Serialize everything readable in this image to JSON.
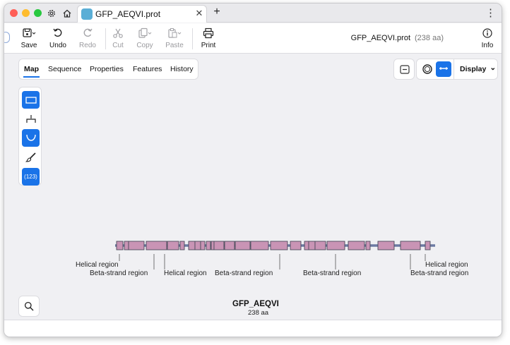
{
  "tab": {
    "title": "GFP_AEQVI.prot"
  },
  "toolbar": {
    "save": "Save",
    "undo": "Undo",
    "redo": "Redo",
    "cut": "Cut",
    "copy": "Copy",
    "paste": "Paste",
    "print": "Print",
    "info": "Info"
  },
  "file": {
    "name": "GFP_AEQVI.prot",
    "length": "(238 aa)"
  },
  "view_tabs": [
    "Map",
    "Sequence",
    "Properties",
    "Features",
    "History"
  ],
  "display_menu": {
    "label": "Display",
    "chevron": "⌄"
  },
  "palette": {
    "numbers_label": "(123)"
  },
  "map": {
    "name": "GFP_AEQVI",
    "length": "238 aa",
    "features": [
      "Helical region",
      "Beta-strand region",
      "Helical region",
      "Beta-strand region",
      "Beta-strand region",
      "Helical region",
      "Beta-strand region"
    ]
  },
  "colors": {
    "accent": "#1a73e8",
    "feature_fill": "#c994b5",
    "feature_stroke": "#4a4a5a",
    "backbone": "#6c7aa3"
  },
  "icons": [
    "gear-icon",
    "home-icon",
    "save-icon",
    "undo-icon",
    "redo-icon",
    "scissors-icon",
    "copy-icon",
    "paste-icon",
    "printer-icon",
    "info-icon",
    "rectangle-icon",
    "tree-icon",
    "arc-icon",
    "brush-icon",
    "circle-icon",
    "linear-icon",
    "magnifier-icon"
  ]
}
